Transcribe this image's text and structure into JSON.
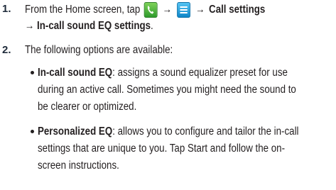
{
  "steps": [
    {
      "number": "1.",
      "lead": "From the Home screen, tap",
      "arrow": "→",
      "menu_target": "Call settings",
      "final_target": "In-call sound EQ settings",
      "final_end": ".",
      "icons": [
        "phone-icon",
        "menu-icon"
      ]
    },
    {
      "number": "2.",
      "text": "The following options are available:"
    }
  ],
  "options": [
    {
      "term": "In-call sound EQ",
      "lines": [
        ": assigns a sound equalizer preset for use",
        "during an active call. Sometimes you might need the sound to",
        "be clearer or optimized."
      ]
    },
    {
      "term": "Personalized EQ",
      "lines": [
        ": allows you to configure and tailor the in-call",
        "settings that are unique to you. Tap Start and follow the on-",
        "screen instructions."
      ]
    }
  ],
  "colors": {
    "number": "#1f2b3a",
    "text": "#231f20",
    "phone_icon": "#3ea832",
    "menu_icon": "#1e9be0"
  }
}
